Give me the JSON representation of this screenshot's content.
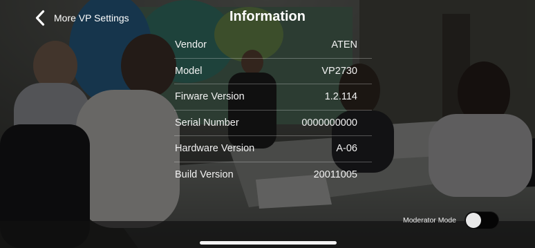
{
  "header": {
    "back_label": "More VP Settings",
    "title": "Information"
  },
  "info": {
    "rows": [
      {
        "label": "Vendor",
        "value": "ATEN"
      },
      {
        "label": "Model",
        "value": "VP2730"
      },
      {
        "label": "Firware Version",
        "value": "1.2.114"
      },
      {
        "label": "Serial Number",
        "value": "0000000000"
      },
      {
        "label": "Hardware Version",
        "value": "A-06"
      },
      {
        "label": "Build Version",
        "value": "20011005"
      }
    ]
  },
  "moderator": {
    "label": "Moderator Mode",
    "enabled": false
  },
  "icons": {
    "back": "chevron-left-icon"
  },
  "colors": {
    "text": "#ffffff",
    "toggle_track_off": "#050505",
    "toggle_knob": "#e9e9e9",
    "divider": "rgba(255,255,255,0.28)"
  }
}
